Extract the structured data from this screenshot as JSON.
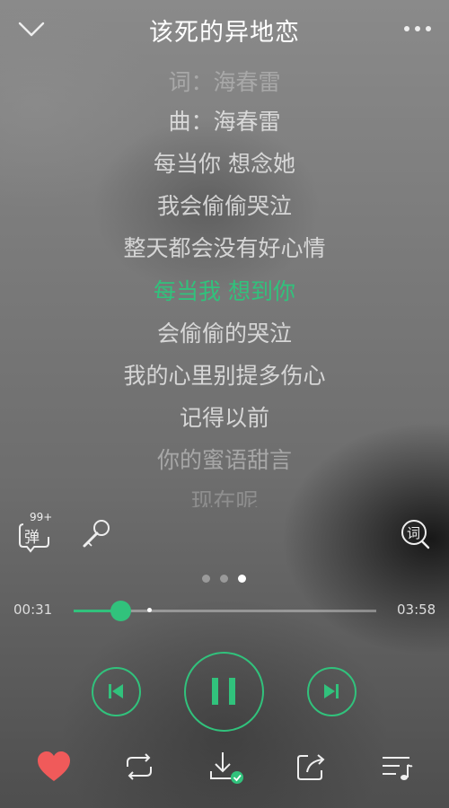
{
  "header": {
    "title": "该死的异地恋"
  },
  "lyrics": [
    {
      "text": "词：海春雷",
      "state": "fade-top"
    },
    {
      "text": "曲：海春雷",
      "state": "normal"
    },
    {
      "text": "每当你 想念她",
      "state": "normal"
    },
    {
      "text": "我会偷偷哭泣",
      "state": "normal"
    },
    {
      "text": "整天都会没有好心情",
      "state": "normal"
    },
    {
      "text": "每当我 想到你",
      "state": "active"
    },
    {
      "text": "会偷偷的哭泣",
      "state": "normal"
    },
    {
      "text": "我的心里别提多伤心",
      "state": "normal"
    },
    {
      "text": "记得以前",
      "state": "normal"
    },
    {
      "text": "你的蜜语甜言",
      "state": "fade-bottom"
    },
    {
      "text": "现在呢",
      "state": "fade-more"
    }
  ],
  "tools": {
    "danmaku_label": "弹",
    "danmaku_count": "99+",
    "lyrics_icon_label": "词"
  },
  "pager": {
    "count": 3,
    "active": 2
  },
  "player": {
    "current_time": "00:31",
    "total_time": "03:58",
    "progress": 0.155,
    "buffered": 0.25,
    "state": "playing"
  },
  "colors": {
    "accent": "#31c27c",
    "favorite": "#f05a5a"
  },
  "icons": {
    "back": "chevron-down-icon",
    "more": "more-dots-icon",
    "danmaku": "danmaku-icon",
    "karaoke": "microphone-icon",
    "lyrics": "lyrics-icon",
    "prev": "skip-previous-icon",
    "pause": "pause-icon",
    "next": "skip-next-icon",
    "favorite": "heart-icon",
    "repeat": "repeat-icon",
    "download": "download-icon",
    "share": "share-icon",
    "playlist": "playlist-icon"
  }
}
